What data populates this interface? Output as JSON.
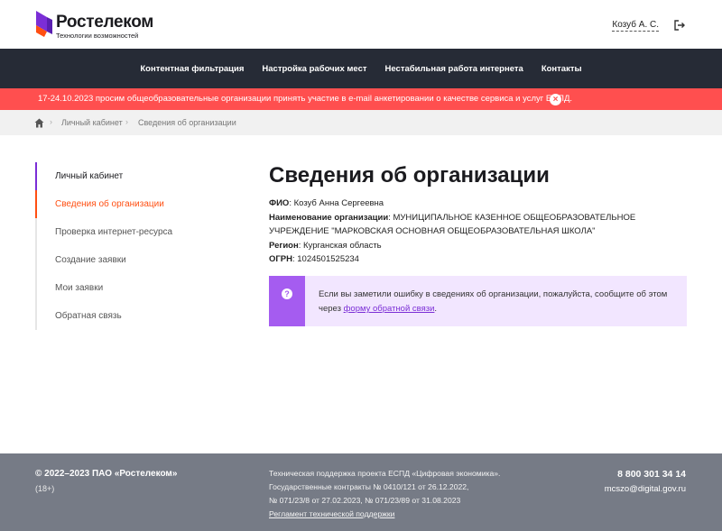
{
  "header": {
    "logo_name": "Ростелеком",
    "logo_sub": "Технологии возможностей",
    "user_name": "Козуб А. С.",
    "logout_icon": "logout-icon"
  },
  "nav": {
    "items": [
      "Контентная фильтрация",
      "Настройка рабочих мест",
      "Нестабильная работа интернета",
      "Контакты"
    ]
  },
  "alert": {
    "text": "17-24.10.2023 просим общеобразовательные организации принять участие в e-mail анкетировании о качестве сервиса и услуг ЕСПД.",
    "close": "×"
  },
  "breadcrumb": {
    "home_icon": "home-icon",
    "items": [
      "Личный кабинет",
      "Сведения об организации"
    ],
    "separator": "›"
  },
  "sidebar": {
    "items": [
      "Личный кабинет",
      "Сведения об организации",
      "Проверка интернет-ресурса",
      "Создание заявки",
      "Мои заявки",
      "Обратная связь"
    ]
  },
  "main": {
    "title": "Сведения об организации",
    "fio_label": "ФИО",
    "fio_value": ": Козуб Анна Сергеевна",
    "org_label": "Наименование организации",
    "org_value": ": МУНИЦИПАЛЬНОЕ КАЗЕННОЕ ОБЩЕОБРАЗОВАТЕЛЬНОЕ УЧРЕЖДЕНИЕ \"МАРКОВСКАЯ ОСНОВНАЯ ОБЩЕОБРАЗОВАТЕЛЬНАЯ ШКОЛА\"",
    "region_label": "Регион",
    "region_value": ": Курганская область",
    "ogrn_label": "ОГРН",
    "ogrn_value": ": 1024501525234"
  },
  "notice": {
    "icon": "?",
    "text_before": "Если вы заметили ошибку в сведениях об организации, пожалуйста, сообщите об этом через ",
    "link": "форму обратной связи",
    "text_after": "."
  },
  "footer": {
    "copyright": "© 2022–2023 ПАО «Ростелеком»",
    "age": "(18+)",
    "support_line1": "Техническая поддержка проекта ЕСПД «Цифровая экономика».",
    "support_line2": "Государственные контракты № 0410/121 от 26.12.2022,",
    "support_line3": "№ 071/23/8 от 27.02.2023, № 071/23/89 от 31.08.2023",
    "support_link": "Регламент технической поддержки",
    "phone": "8 800 301 34 14",
    "email": "mcszo@digital.gov.ru"
  },
  "colors": {
    "brand_purple": "#7b2ed6",
    "brand_orange": "#ff4f12",
    "nav_bg": "#262b36",
    "alert_bg": "#ff4f4f",
    "footer_bg": "#767b86",
    "notice_bg": "#f2e6ff"
  }
}
